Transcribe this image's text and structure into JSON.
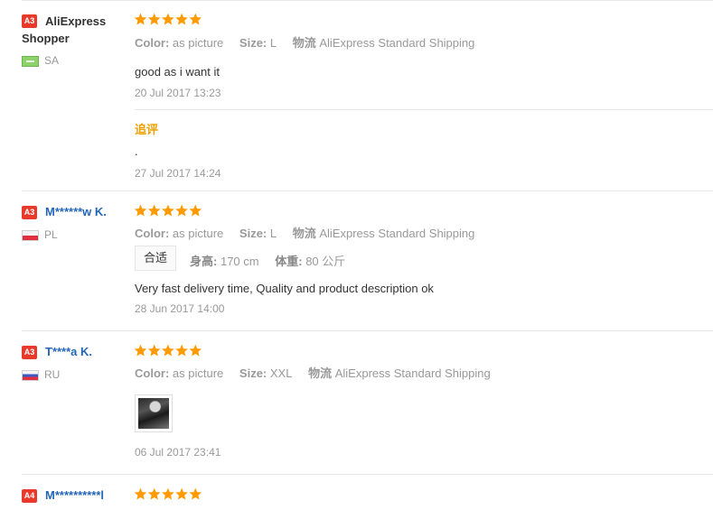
{
  "reviews": [
    {
      "level": "A3",
      "name": "AliExpress Shopper",
      "country": "SA",
      "attrs": {
        "color_label": "Color:",
        "color": "as picture",
        "size_label": "Size:",
        "size": "L",
        "logistics_label": "物流",
        "logistics": "AliExpress Standard Shipping"
      },
      "text": "good as i want it",
      "date": "20 Jul 2017 13:23",
      "additional": {
        "label": "追评",
        "text": ".",
        "date": "27 Jul 2017 14:24"
      }
    },
    {
      "level": "A3",
      "name": "M******w K.",
      "country": "PL",
      "attrs": {
        "color_label": "Color:",
        "color": "as picture",
        "size_label": "Size:",
        "size": "L",
        "logistics_label": "物流",
        "logistics": "AliExpress Standard Shipping"
      },
      "fit": "合适",
      "height_label": "身高:",
      "height": "170 cm",
      "weight_label": "体重:",
      "weight": "80 公斤",
      "text": "Very fast delivery time, Quality and product description ok",
      "date": "28 Jun 2017 14:00"
    },
    {
      "level": "A3",
      "name": "T****a K.",
      "country": "RU",
      "attrs": {
        "color_label": "Color:",
        "color": "as picture",
        "size_label": "Size:",
        "size": "XXL",
        "logistics_label": "物流",
        "logistics": "AliExpress Standard Shipping"
      },
      "date": "06 Jul 2017 23:41"
    },
    {
      "level": "A4",
      "name": "M**********l"
    }
  ],
  "colors": {
    "star": "#ff9a00",
    "badge": "#e8392b",
    "link_blue": "#2366b5",
    "additional": "#f0a000"
  },
  "icons": {
    "star": "star-icon",
    "flag": "flag-icon",
    "photo": "review-photo"
  }
}
